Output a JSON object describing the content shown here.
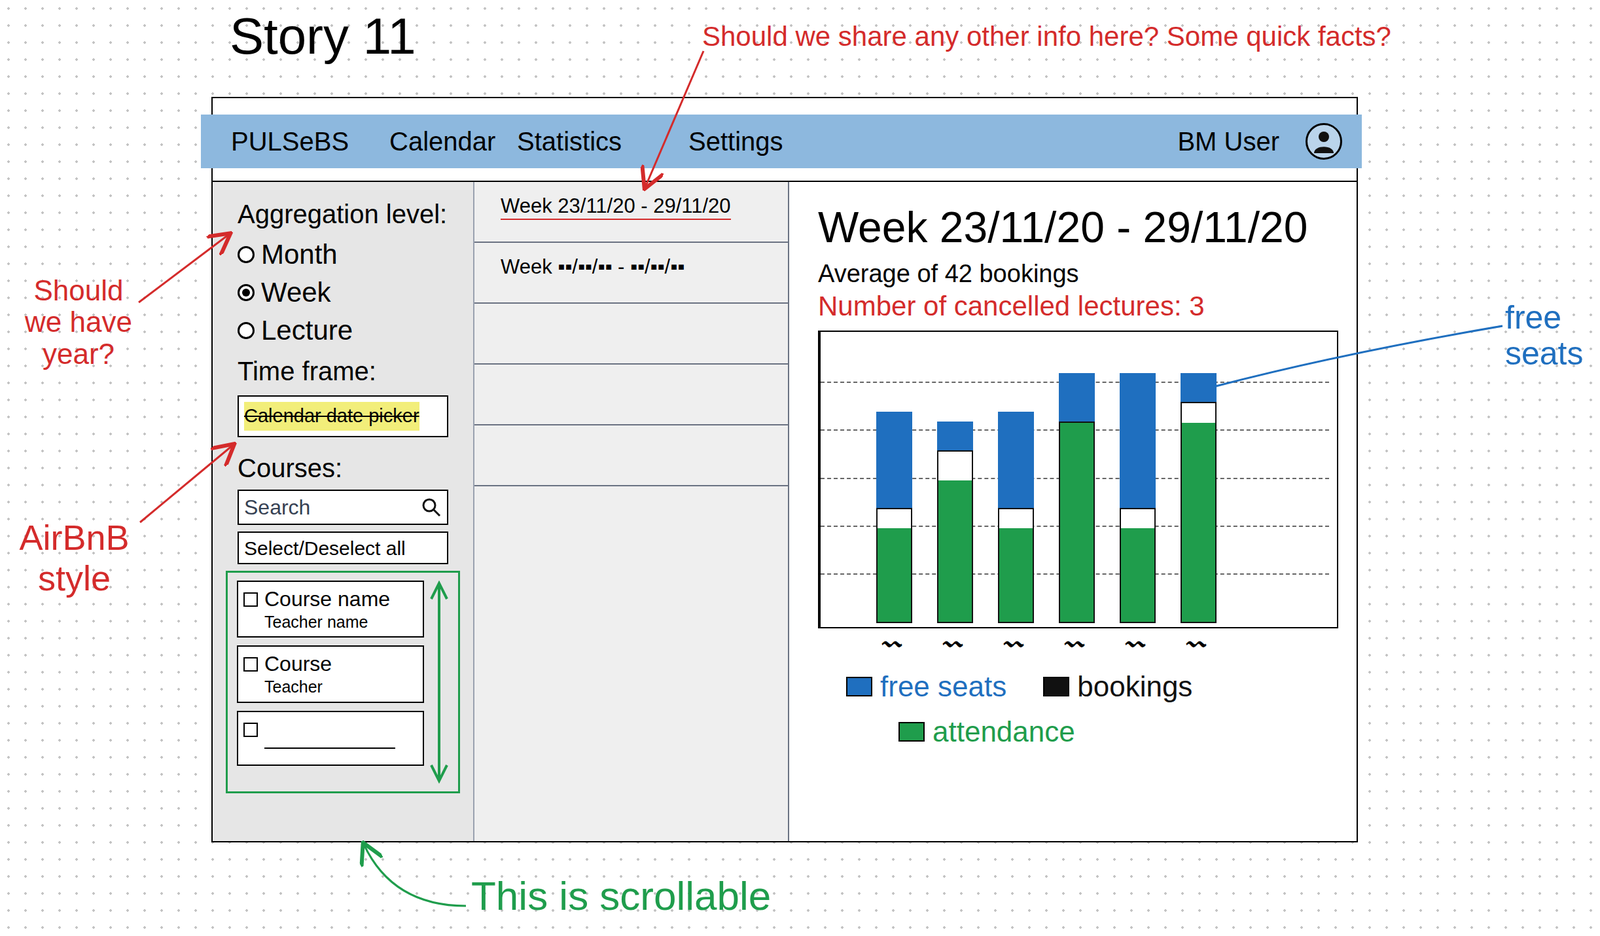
{
  "title": "Story 11",
  "annotations": [
    {
      "text": "Should we share any other info here? Some quick facts?",
      "color": "#d42b2b"
    },
    {
      "text": "Should we have year?",
      "color": "#d42b2b"
    },
    {
      "text": "AirBnB style",
      "color": "#d42b2b"
    },
    {
      "text": "This is scrollable",
      "color": "#1f9d4c"
    },
    {
      "text": "free seats",
      "color": "#1f6fbf"
    }
  ],
  "navbar": {
    "brand": "PULSeBS",
    "items": [
      "Calendar",
      "Statistics",
      "Settings"
    ],
    "user": "BM User"
  },
  "sidebar": {
    "aggregation_label": "Aggregation level:",
    "aggregation_options": [
      {
        "label": "Month",
        "selected": false
      },
      {
        "label": "Week",
        "selected": true
      },
      {
        "label": "Lecture",
        "selected": false
      }
    ],
    "time_frame_label": "Time frame:",
    "date_picker": {
      "text": "Calendar date picker",
      "struck": true,
      "highlighted": true
    },
    "courses_label": "Courses:",
    "search": {
      "placeholder": "Search"
    },
    "select_all": "Select/Deselect all",
    "courses": [
      {
        "kind": "course",
        "name": "Course name",
        "teacher": "Teacher name",
        "checked": false
      },
      {
        "kind": "course",
        "name": "Course",
        "teacher": "Teacher",
        "checked": false
      },
      {
        "kind": "blank",
        "name": "",
        "teacher": "",
        "checked": false
      }
    ]
  },
  "weeks": [
    {
      "label": "Week 23/11/20 - 29/11/20",
      "selected": true
    },
    {
      "label": "Week ▪▪/▪▪/▪▪ - ▪▪/▪▪/▪▪",
      "selected": false
    },
    {
      "label": "",
      "selected": false
    },
    {
      "label": "",
      "selected": false
    },
    {
      "label": "",
      "selected": false
    }
  ],
  "detail": {
    "title": "Week 23/11/20 - 29/11/20",
    "average": "Average of 42 bookings",
    "cancelled": "Number of cancelled lectures: 3"
  },
  "chart": {
    "max": 60,
    "ticks": [
      10,
      20,
      30,
      40,
      50
    ],
    "categories": [
      "〰",
      "〰",
      "〰",
      "〰",
      "〰",
      "〰"
    ],
    "series": [
      {
        "name": "free seats",
        "color": "#1f6fbf",
        "values": [
          20,
          6,
          20,
          10,
          28,
          6
        ]
      },
      {
        "name": "bookings",
        "color": "#111111",
        "values": [
          24,
          36,
          24,
          42,
          24,
          46
        ]
      },
      {
        "name": "attendance",
        "color": "#1f9d4c",
        "values": [
          20,
          30,
          20,
          42,
          20,
          42
        ]
      }
    ]
  }
}
